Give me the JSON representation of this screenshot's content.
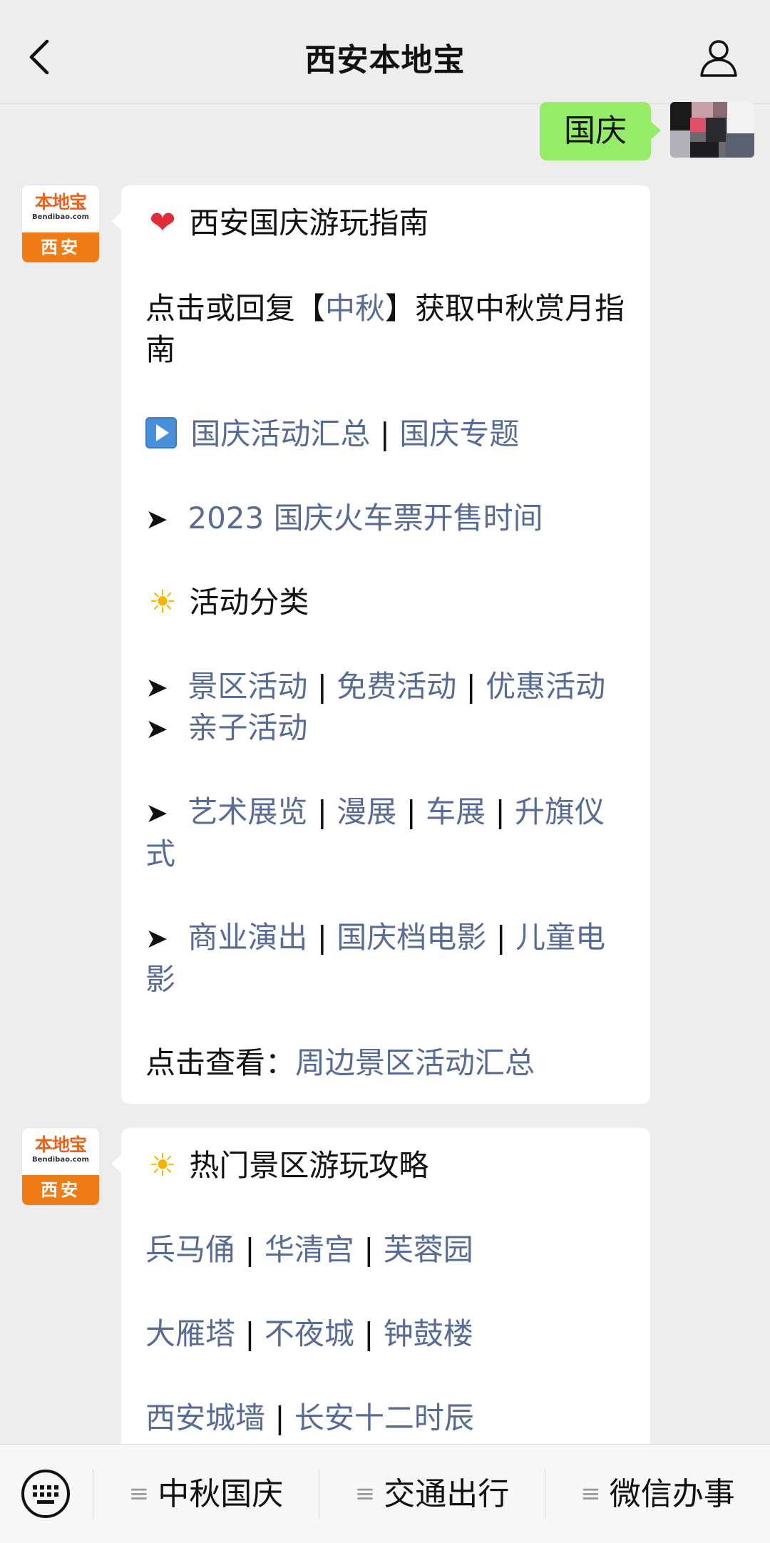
{
  "header": {
    "title": "西安本地宝",
    "back_icon": "chevron-left-icon",
    "profile_icon": "person-icon"
  },
  "outgoing": {
    "text": "国庆"
  },
  "bot": {
    "avatar_logo": "本地宝",
    "avatar_site": "Bendibao.com",
    "avatar_city": "西安"
  },
  "msg1": {
    "title": "西安国庆游玩指南",
    "mid_pre": "点击或回复【",
    "mid_link": "中秋",
    "mid_post": "】获取中秋赏月指南",
    "row1": [
      "国庆活动汇总",
      "国庆专题"
    ],
    "row2": "2023 国庆火车票开售时间",
    "section": "活动分类",
    "row3": [
      "景区活动",
      "免费活动",
      "优惠活动"
    ],
    "row4": "亲子活动",
    "row5": [
      "艺术展览",
      "漫展",
      "车展",
      "升旗仪式"
    ],
    "row6": [
      "商业演出",
      "国庆档电影",
      "儿童电影"
    ],
    "footer_label": "点击查看：",
    "footer_link": "周边景区活动汇总"
  },
  "msg2": {
    "title": "热门景区游玩攻略",
    "row1": [
      "兵马俑",
      "华清宫",
      "芙蓉园"
    ],
    "row2": [
      "大雁塔",
      "不夜城",
      "钟鼓楼"
    ],
    "row3": [
      "西安城墙",
      "长安十二时辰"
    ]
  },
  "bottom": {
    "keyboard_icon": "keyboard-icon",
    "menus": [
      "中秋国庆",
      "交通出行",
      "微信办事"
    ]
  },
  "colors": {
    "link": "#576b95",
    "outgoing_bubble": "#95ec69",
    "brand_orange": "#f07c17",
    "background": "#ededed"
  }
}
